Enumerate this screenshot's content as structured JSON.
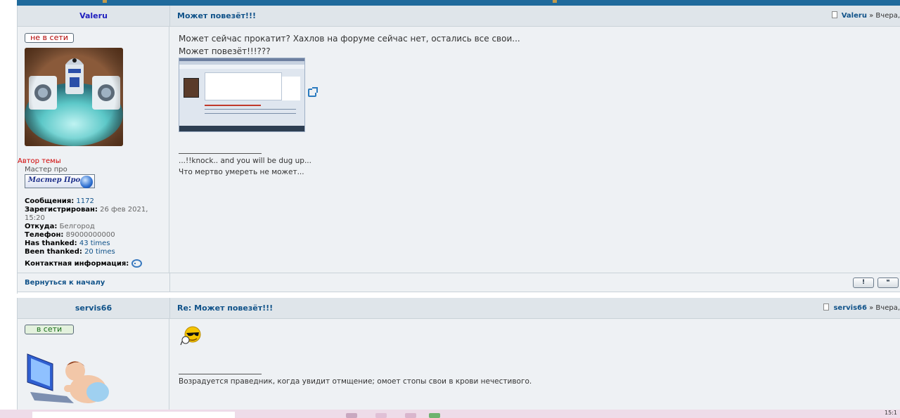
{
  "post1": {
    "author": "Valeru",
    "subject": "Может повезёт!!!",
    "meta_author": "Valeru",
    "meta_date": "» Вчера,",
    "status": "не в сети",
    "topic_starter": "Автор темы",
    "rank_title": "Мастер про",
    "rank_image_text": "Мастер Про",
    "profile": {
      "messages_label": "Сообщения:",
      "messages_value": "1172",
      "registered_label": "Зарегистрирован:",
      "registered_value": "26 фев 2021, 15:20",
      "from_label": "Откуда:",
      "from_value": "Белгород",
      "phone_label": "Телефон:",
      "phone_value": "89000000000",
      "has_thanked_label": "Has thanked:",
      "has_thanked_value": "43 times",
      "been_thanked_label": "Been thanked:",
      "been_thanked_value": "20 times",
      "contact_label": "Контактная информация:"
    },
    "text_line1": "Может сейчас прокатит? Хахлов на форуме сейчас нет, остались все свои...",
    "text_line2": "Может повезёт!!!???",
    "signature_line1": "...!!knock.. and you will be dug up...",
    "signature_line2": "Что мертво умереть не может...",
    "back_to_top": "Вернуться к началу",
    "report_button": "!",
    "quote_button": "❝"
  },
  "post2": {
    "author": "servis66",
    "subject": "Re: Может повезёт!!!",
    "meta_author": "servis66",
    "meta_date": "» Вчера,",
    "status": "в сети",
    "signature_line1": "Возрадуется праведник, когда увидит отмщение; омоет стопы свои в крови нечестивого."
  },
  "taskbar": {
    "clock": "15:1"
  },
  "colors": {
    "accent_blue": "#105289",
    "header_bg": "#dfe5ea",
    "body_bg": "#eef1f4",
    "offline_red": "#b00000",
    "online_green": "#1a6e1a",
    "taskbar_pink": "#eedce9"
  }
}
